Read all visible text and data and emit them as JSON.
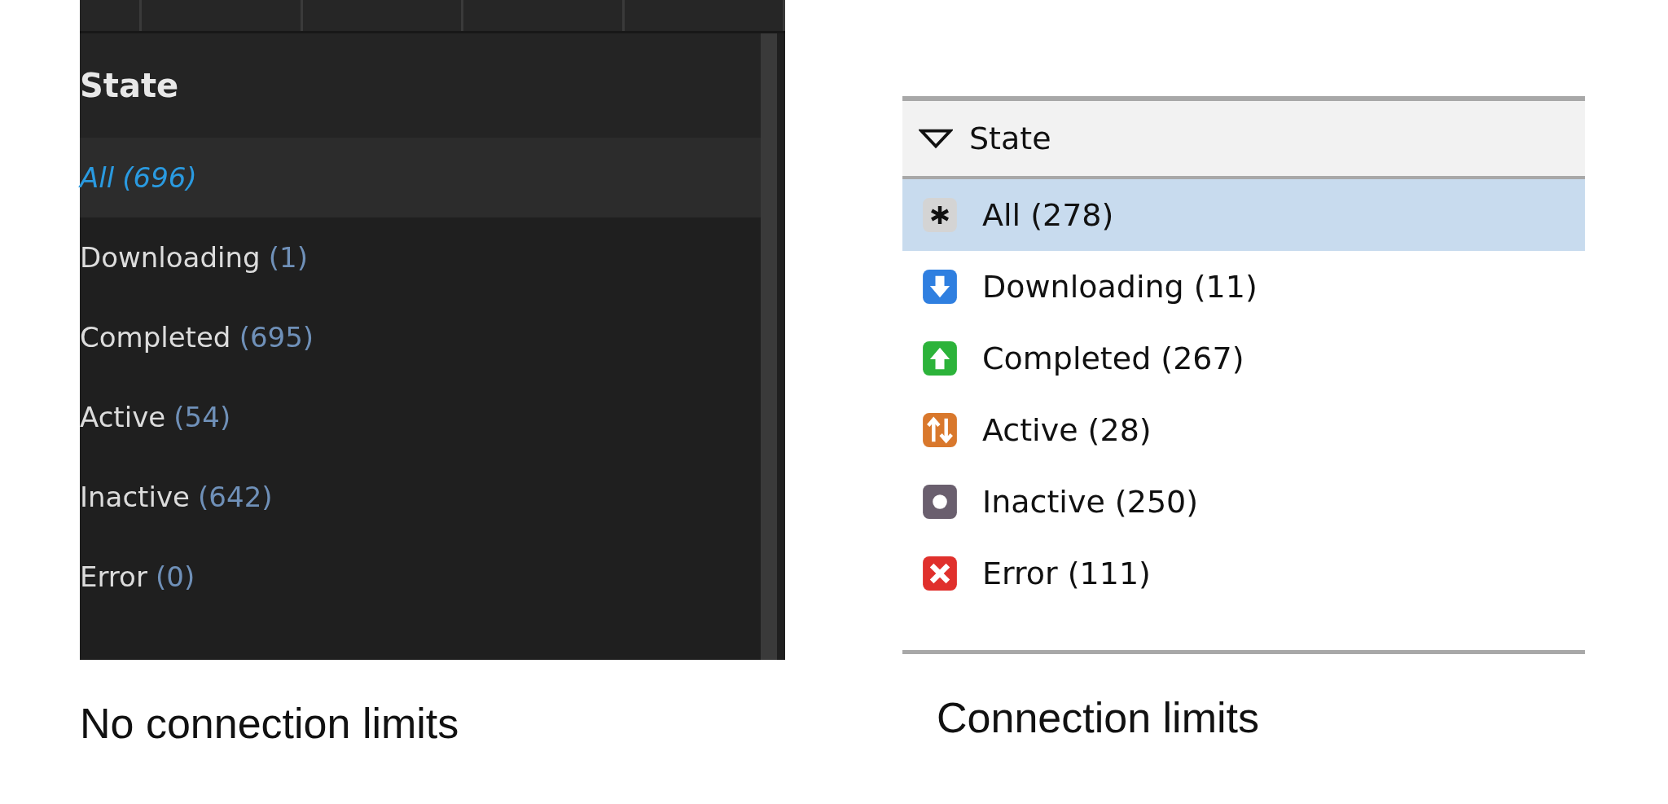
{
  "panels": [
    {
      "kind": "dark",
      "header": "State",
      "caption": "No connection limits",
      "items": [
        {
          "label": "All",
          "count": "(696)",
          "selected": true
        },
        {
          "label": "Downloading",
          "count": "(1)",
          "selected": false
        },
        {
          "label": "Completed",
          "count": "(695)",
          "selected": false
        },
        {
          "label": "Active",
          "count": "(54)",
          "selected": false
        },
        {
          "label": "Inactive",
          "count": "(642)",
          "selected": false
        },
        {
          "label": "Error",
          "count": "(0)",
          "selected": false
        }
      ]
    },
    {
      "kind": "light",
      "header": "State",
      "caption": "Connection limits",
      "items": [
        {
          "kind": "all",
          "label": "All",
          "count": "(278)",
          "selected": true
        },
        {
          "kind": "downloading",
          "label": "Downloading",
          "count": "(11)",
          "selected": false
        },
        {
          "kind": "completed",
          "label": "Completed",
          "count": "(267)",
          "selected": false
        },
        {
          "kind": "active",
          "label": "Active",
          "count": "(28)",
          "selected": false
        },
        {
          "kind": "inactive",
          "label": "Inactive",
          "count": "(250)",
          "selected": false
        },
        {
          "kind": "error",
          "label": "Error",
          "count": "(111)",
          "selected": false
        }
      ]
    }
  ]
}
